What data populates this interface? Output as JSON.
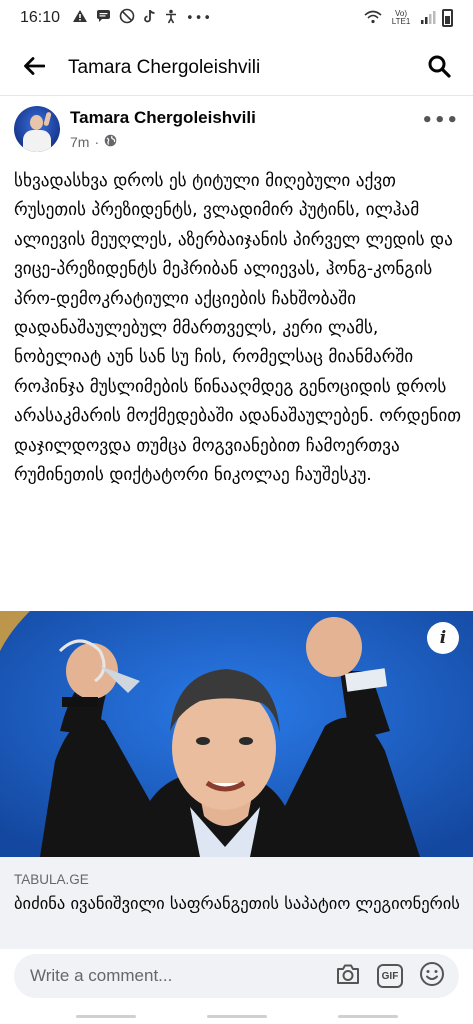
{
  "status_bar": {
    "time": "16:10",
    "network_label": "Vo) LTE1",
    "notification_icons": [
      "alert-icon",
      "message-icon",
      "blocked-icon",
      "tiktok-icon",
      "accessibility-icon",
      "more-dots-icon"
    ]
  },
  "top_bar": {
    "title": "Tamara Chergoleishvili"
  },
  "post": {
    "author": "Tamara Chergoleishvili",
    "time": "7m",
    "separator": "·",
    "audience_icon": "globe-icon",
    "text": "სხვადასხვა დროს ეს ტიტული მიღებული აქვთ რუსეთის პრეზიდენტს, ვლადიმირ პუტინს, ილჰამ ალიევის მეუღლეს, აზერბაიჯანის პირველ ლედის და ვიცე-პრეზიდენტს მეჰრიბან ალიევას, ჰონგ-კონგის პრო-დემოკრატიული აქციების ჩახშობაში დადანაშაულებულ მმართველს, კერი ლამს, ნობელიატ აუნ სან სუ ჩის, რომელსაც მიანმარში როჰინჯა მუსლიმების წინააღმდეგ გენოციდის დროს არასაკმარის მოქმედებაში ადანაშაულებენ. ორდენით დაჯილდოვდა თუმცა მოგვიანებით ჩამოერთვა რუმინეთის დიქტატორი ნიკოლაე ჩაუშესკუ."
  },
  "link_preview": {
    "info_label": "i",
    "domain": "TABULA.GE",
    "title": "ბიძინა ივანიშვილი საფრანგეთის საპატიო ლეგიონერის ორდენით დაჯილ..."
  },
  "comment_bar": {
    "placeholder": "Write a comment...",
    "gif_label": "GIF"
  },
  "colors": {
    "link_background": "#f0f2f5",
    "image_background": "#1a5cc4",
    "meta_text": "#65676b"
  }
}
